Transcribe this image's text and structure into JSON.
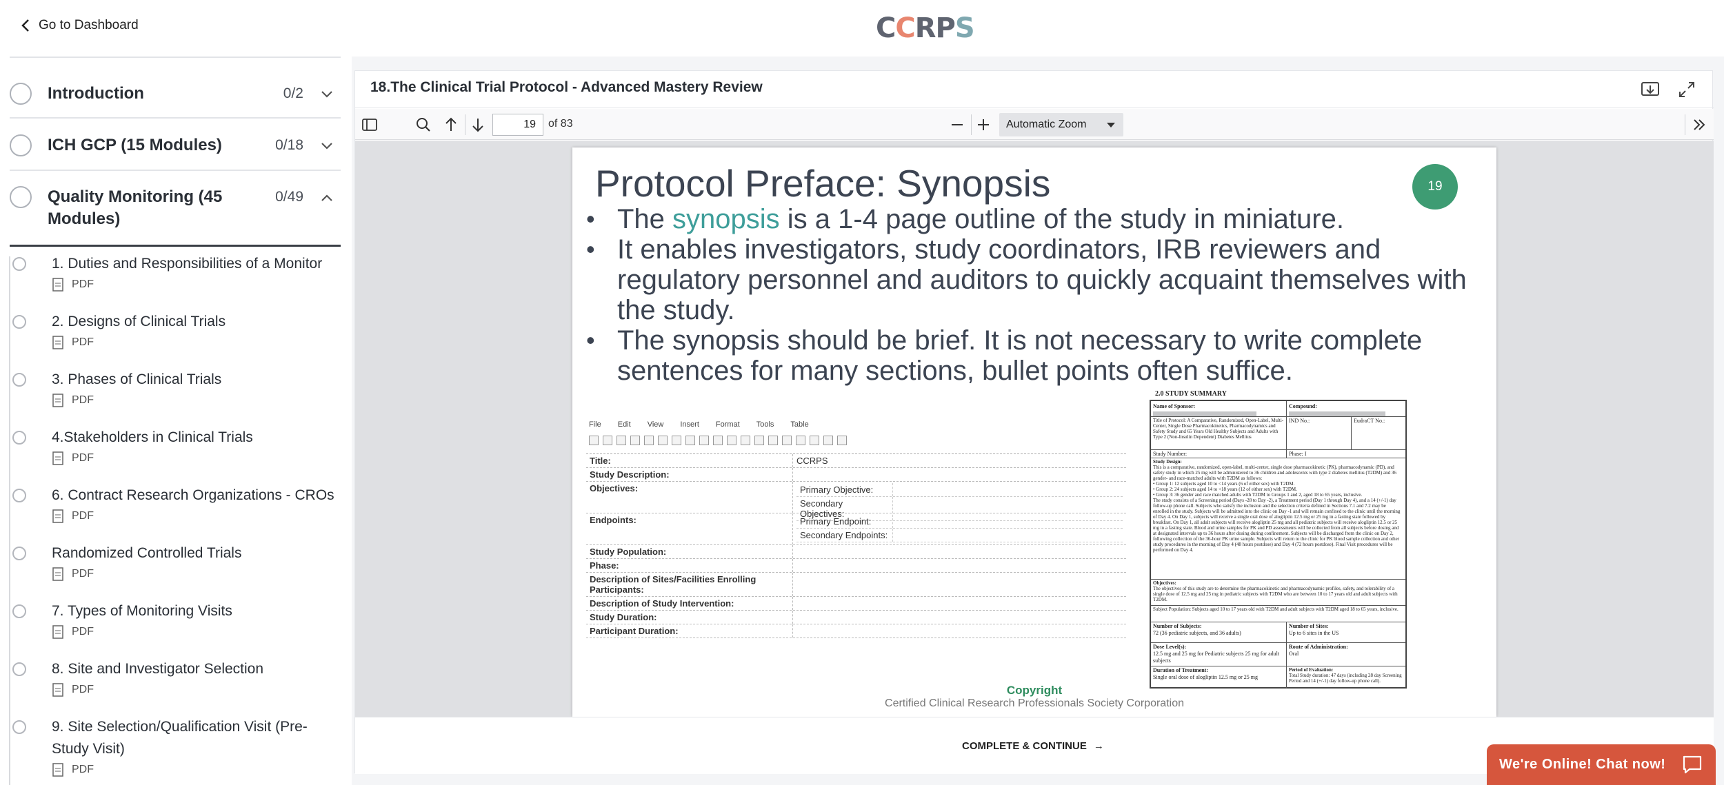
{
  "header": {
    "back_label": "Go to Dashboard",
    "logo_letters": [
      "C",
      "C",
      "R",
      "P",
      "S"
    ]
  },
  "sidebar": {
    "sections": [
      {
        "title": "Introduction",
        "count": "0/2",
        "expanded": false
      },
      {
        "title": "ICH GCP (15 Modules)",
        "count": "0/18",
        "expanded": false
      },
      {
        "title": "Quality Monitoring (45 Modules)",
        "count": "0/49",
        "expanded": true
      }
    ],
    "lessons": [
      {
        "title": "1. Duties and Responsibilities of a Monitor",
        "type": "PDF"
      },
      {
        "title": "2. Designs of Clinical Trials",
        "type": "PDF"
      },
      {
        "title": "3. Phases of Clinical Trials",
        "type": "PDF"
      },
      {
        "title": "4.Stakeholders in Clinical Trials",
        "type": "PDF"
      },
      {
        "title": "6. Contract Research Organizations - CROs",
        "type": "PDF"
      },
      {
        "title": "Randomized Controlled Trials",
        "type": "PDF"
      },
      {
        "title": "7. Types of Monitoring Visits",
        "type": "PDF"
      },
      {
        "title": "8. Site and Investigator Selection",
        "type": "PDF"
      },
      {
        "title": "9. Site Selection/Qualification Visit (Pre-Study Visit)",
        "type": "PDF"
      }
    ]
  },
  "main": {
    "title": "18.The Clinical Trial Protocol - Advanced Mastery Review",
    "footer_button": "COMPLETE & CONTINUE",
    "footer_arrow": "→"
  },
  "pdf_toolbar": {
    "current_page": "19",
    "page_of": "of 83",
    "zoom": "Automatic Zoom"
  },
  "slide": {
    "title": "Protocol Preface: Synopsis",
    "page_number": "19",
    "bullet1_pre": "The ",
    "bullet1_highlight": "synopsis",
    "bullet1_post": " is a 1-4 page outline of the study in miniature.",
    "bullet2": "It enables investigators, study coordinators, IRB reviewers and regulatory personnel and auditors to quickly acquaint themselves with the study.",
    "bullet3": "The synopsis should be brief. It is not necessary to write complete sentences for many sections, bullet points often suffice.",
    "highlight_color": "#3e9e9a",
    "copyright": "Copyright",
    "corporation": "Certified Clinical Research Professionals Society Corporation",
    "editor": {
      "menu": [
        "File",
        "Edit",
        "View",
        "Insert",
        "Format",
        "Tools",
        "Table"
      ],
      "rows": [
        {
          "key": "Title:",
          "value": "CCRPS"
        },
        {
          "key": "Study Description:",
          "value": ""
        },
        {
          "key": "Objectives:",
          "sub": [
            "Primary Objective:",
            "Secondary Objectives:"
          ]
        },
        {
          "key": "Endpoints:",
          "sub": [
            "Primary Endpoint:",
            "Secondary Endpoints:"
          ]
        },
        {
          "key": "Study Population:",
          "value": ""
        },
        {
          "key": "Phase:",
          "value": ""
        },
        {
          "key": "Description of Sites/Facilities Enrolling Participants:",
          "value": ""
        },
        {
          "key": "Description of Study Intervention:",
          "value": ""
        },
        {
          "key": "Study Duration:",
          "value": ""
        },
        {
          "key": "Participant Duration:",
          "value": ""
        }
      ]
    },
    "summary": {
      "heading": "2.0      STUDY SUMMARY",
      "name_of_sponsor": "Name of Sponsor:",
      "compound": "Compound:",
      "title_of_protocol": "Title of Protocol: A Comparative, Randomized, Open-Label, Multi-Center, Single Dose Pharmacokinetics, Pharmacodynamics and Safety Study and 65 Years Old Healthy Subjects and Adults with Type 2 (Non-Insulin Dependent) Diabetes Mellitus",
      "ind_no": "IND No.:",
      "eudract_no": "EudraCT No.:",
      "study_number": "Study Number:",
      "phase": "Phase: I",
      "study_design": "Study Design:",
      "design_text": "This is a comparative, randomized, open-label, multi-center, single dose pharmacokinetic (PK), pharmacodynamic (PD), and safety study in which 25 mg will be administered to 36 children and adolescents with type 2 diabetes mellitus (T2DM) and 36 gender- and race-matched adults with T2DM as follows:",
      "group1": "Group 1: 12 subjects aged 10 to <14 years (6 of either sex) with T2DM.",
      "group2": "Group 2: 24 subjects aged 14 to <18 years (12 of either sex) with T2DM.",
      "group3": "Group 3: 36 gender and race matched adults with T2DM to Groups 1 and 2, aged 18 to 65 years, inclusive.",
      "design_text2": "The study consists of a Screening period (Days -28 to Day -2), a Treatment period (Day 1 through Day 4), and a 14 (+/-1) day follow-up phone call. Subjects who satisfy the inclusion and the selection criteria defined in Sections 7.1 and 7.2 may be enrolled in the study. Subjects will be admitted into the clinic on Day -1 and will remain confined to the clinic until the morning of Day 4. On Day 1, subjects will receive a single oral dose of alogliptin 12.5 mg or 25 mg in a fasting state followed by breakfast. On Day 1, all adult subjects will receive alogliptin 25 mg and all pediatric subjects will receive alogliptin 12.5 or 25 mg in a fasting state. Blood and urine samples for PK and PD assessments will be collected from all subjects before dosing and at designated intervals up to 36 hours after dosing during confinement. Subjects will be discharged from the clinic on Day 2, following collection of the 36-hour PK urine sample. Subjects will return to the clinic for PK blood sample collection and other study procedures in the morning of Day 4 (48 hours postdose) and Day 4 (72 hours postdose). Final Visit procedures will be performed on Day 4.",
      "objectives": "Objectives:",
      "objectives_text": "The objectives of this study are to determine the pharmacokinetic and pharmacodynamic profiles, safety, and tolerability of a single dose of 12.5 mg and 25 mg in pediatric subjects with T2DM who are between 10 to 17 years old and adult subjects with T2DM.",
      "subject_population": "Subject Population: Subjects aged 10 to 17 years old with T2DM and adult subjects with T2DM aged 18 to 65 years, inclusive.",
      "number_of_subjects": "Number of Subjects:",
      "number_of_subjects_val": "72 (36 pediatric subjects, and 36 adults)",
      "number_of_sites": "Number of Sites:",
      "number_of_sites_val": "Up to 6 sites in the US",
      "dose_levels": "Dose Level(s):",
      "dose_levels_val": "12.5 mg and 25 mg for Pediatric subjects 25 mg for adult subjects",
      "route": "Route of Administration:",
      "route_val": "Oral",
      "duration": "Duration of Treatment:",
      "duration_val": "Single oral dose of alogliptin 12.5 mg or 25 mg",
      "period": "Period of Evaluation:",
      "period_val": "Total Study duration: 47 days (including 28 day Screening Period and 14 (+/-1) day follow-up phone call)."
    }
  },
  "chat": {
    "label": "We're Online! Chat now!",
    "color": "#d6563d"
  }
}
